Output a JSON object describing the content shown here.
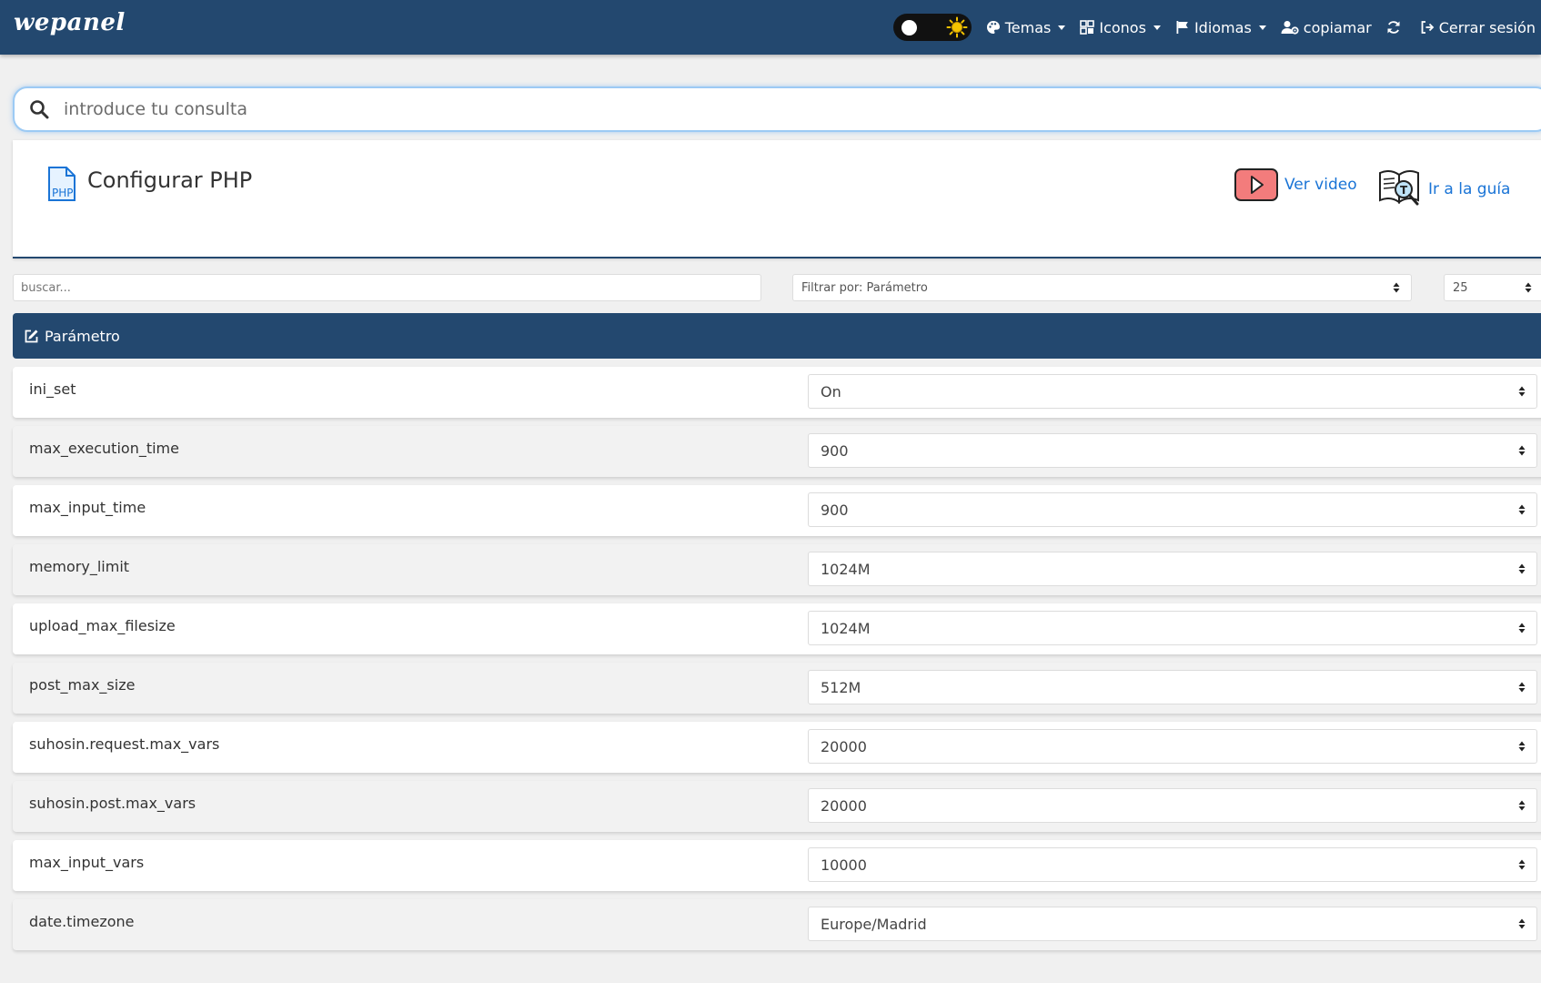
{
  "nav": {
    "brand": "wepanel",
    "temas": "Temas",
    "iconos": "Iconos",
    "idiomas": "Idiomas",
    "user": "copiamar",
    "logout": "Cerrar sesión"
  },
  "search": {
    "placeholder": "introduce tu consulta"
  },
  "header": {
    "title": "Configurar PHP",
    "icon_text": "PHP",
    "video_label": "Ver video",
    "guide_label": "Ir a la guía"
  },
  "filters": {
    "search_placeholder": "buscar...",
    "filter_by": "Filtrar por: Parámetro",
    "page_size": "25"
  },
  "table": {
    "header": "Parámetro",
    "rows": [
      {
        "param": "ini_set",
        "value": "On"
      },
      {
        "param": "max_execution_time",
        "value": "900"
      },
      {
        "param": "max_input_time",
        "value": "900"
      },
      {
        "param": "memory_limit",
        "value": "1024M"
      },
      {
        "param": "upload_max_filesize",
        "value": "1024M"
      },
      {
        "param": "post_max_size",
        "value": "512M"
      },
      {
        "param": "suhosin.request.max_vars",
        "value": "20000"
      },
      {
        "param": "suhosin.post.max_vars",
        "value": "20000"
      },
      {
        "param": "max_input_vars",
        "value": "10000"
      },
      {
        "param": "date.timezone",
        "value": "Europe/Madrid"
      }
    ]
  },
  "colors": {
    "primary": "#23486f",
    "link": "#1a74d6",
    "video_red": "#e53935",
    "sun": "#f5c400"
  }
}
